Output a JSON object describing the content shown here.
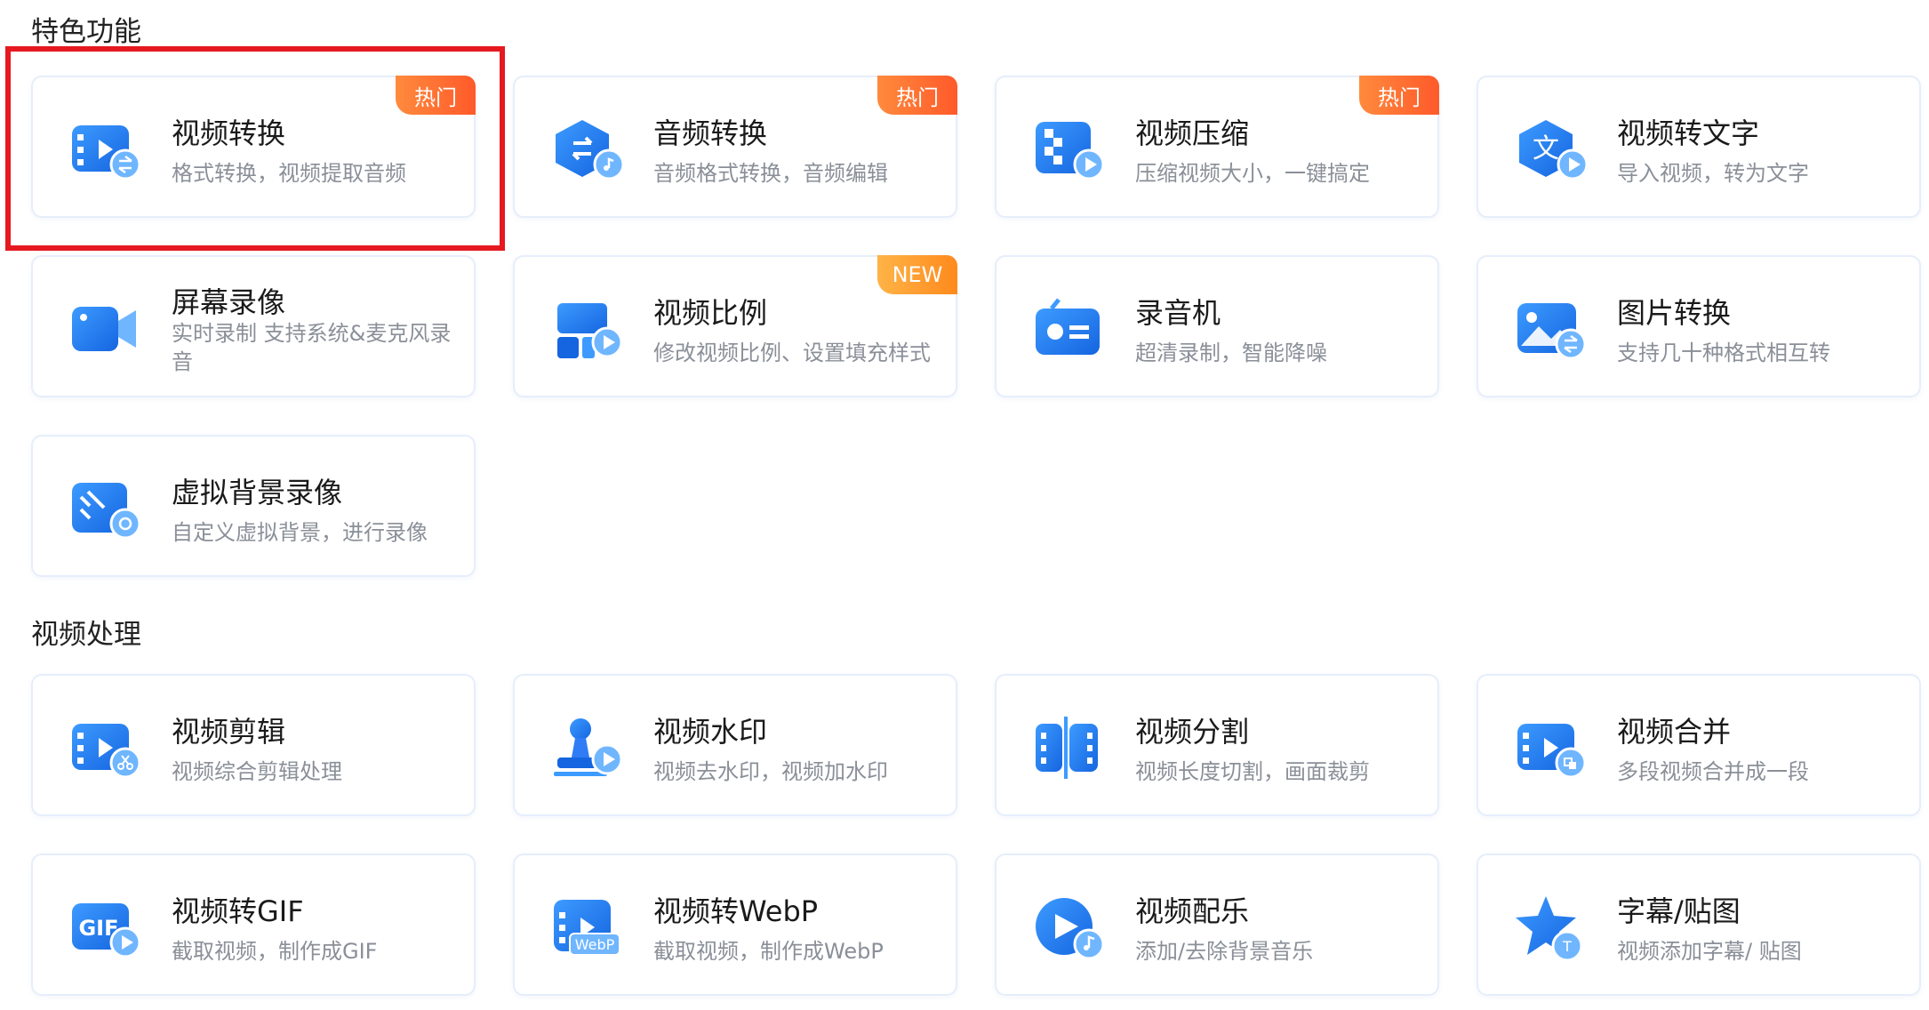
{
  "sections": [
    {
      "title": "特色功能",
      "cards": [
        {
          "name": "video-convert",
          "title": "视频转换",
          "desc": "格式转换，视频提取音频",
          "badge": "热门",
          "icon": "video-convert-icon"
        },
        {
          "name": "audio-convert",
          "title": "音频转换",
          "desc": "音频格式转换，音频编辑",
          "badge": "热门",
          "icon": "audio-convert-icon"
        },
        {
          "name": "video-compress",
          "title": "视频压缩",
          "desc": "压缩视频大小，一键搞定",
          "badge": "热门",
          "icon": "video-compress-icon"
        },
        {
          "name": "video-to-text",
          "title": "视频转文字",
          "desc": "导入视频，转为文字",
          "badge": "",
          "icon": "video-to-text-icon"
        },
        {
          "name": "screen-record",
          "title": "屏幕录像",
          "desc": "实时录制 支持系统&麦克风录音",
          "badge": "",
          "icon": "screen-record-icon"
        },
        {
          "name": "video-ratio",
          "title": "视频比例",
          "desc": "修改视频比例、设置填充样式",
          "badge": "NEW",
          "icon": "video-ratio-icon"
        },
        {
          "name": "recorder",
          "title": "录音机",
          "desc": "超清录制，智能降噪",
          "badge": "",
          "icon": "recorder-icon"
        },
        {
          "name": "image-convert",
          "title": "图片转换",
          "desc": "支持几十种格式相互转",
          "badge": "",
          "icon": "image-convert-icon"
        },
        {
          "name": "virtual-bg-record",
          "title": "虚拟背景录像",
          "desc": "自定义虚拟背景，进行录像",
          "badge": "",
          "icon": "virtual-background-icon"
        }
      ]
    },
    {
      "title": "视频处理",
      "cards": [
        {
          "name": "video-edit",
          "title": "视频剪辑",
          "desc": "视频综合剪辑处理",
          "badge": "",
          "icon": "video-edit-icon"
        },
        {
          "name": "video-watermark",
          "title": "视频水印",
          "desc": "视频去水印，视频加水印",
          "badge": "",
          "icon": "watermark-stamp-icon"
        },
        {
          "name": "video-split",
          "title": "视频分割",
          "desc": "视频长度切割，画面裁剪",
          "badge": "",
          "icon": "video-split-icon"
        },
        {
          "name": "video-merge",
          "title": "视频合并",
          "desc": "多段视频合并成一段",
          "badge": "",
          "icon": "video-merge-icon"
        },
        {
          "name": "video-to-gif",
          "title": "视频转GIF",
          "desc": "截取视频，制作成GIF",
          "badge": "",
          "icon": "gif-icon"
        },
        {
          "name": "video-to-webp",
          "title": "视频转WebP",
          "desc": "截取视频，制作成WebP",
          "badge": "",
          "icon": "webp-icon"
        },
        {
          "name": "video-music",
          "title": "视频配乐",
          "desc": "添加/去除背景音乐",
          "badge": "",
          "icon": "video-music-icon"
        },
        {
          "name": "subtitle-sticker",
          "title": "字幕/贴图",
          "desc": "视频添加字幕/ 贴图",
          "badge": "",
          "icon": "subtitle-sticker-icon"
        }
      ]
    }
  ],
  "icon_text": {
    "gif": "GIF",
    "webp": "WebP",
    "text_glyph": "文",
    "subtitle_glyph": "T"
  },
  "colors": {
    "primary": "#2f7cf6",
    "accent": "#1565e0",
    "badge_hot": "#ff5a2a",
    "badge_new": "#ff8a1d",
    "highlight": "#e5191f"
  }
}
